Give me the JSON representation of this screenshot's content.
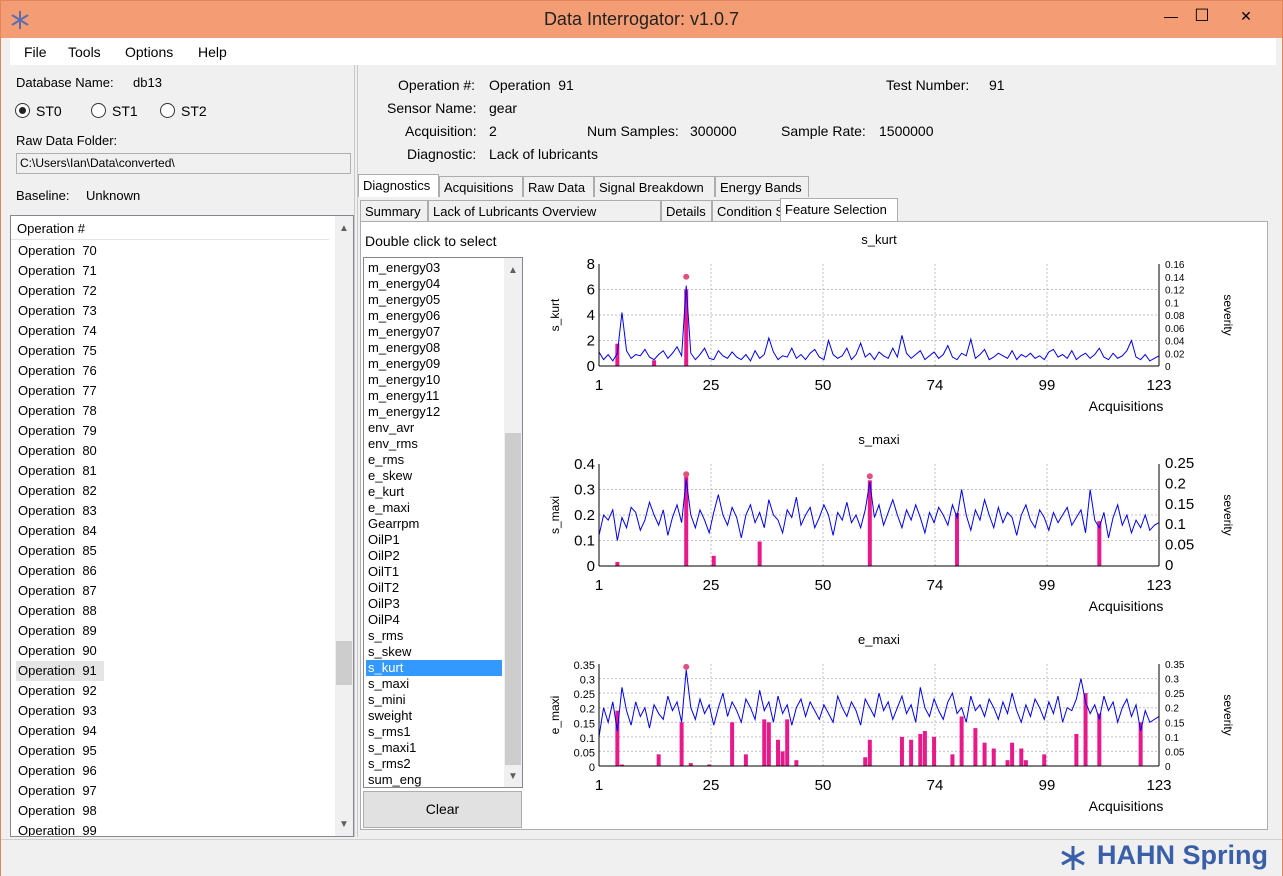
{
  "window": {
    "title": "Data Interrogator: v1.0.7",
    "minimize": "—",
    "maximize": "☐",
    "close": "✕"
  },
  "menu": [
    "File",
    "Tools",
    "Options",
    "Help"
  ],
  "left": {
    "db_label": "Database Name:",
    "db_value": "db13",
    "radios": [
      {
        "label": "ST0",
        "checked": true
      },
      {
        "label": "ST1",
        "checked": false
      },
      {
        "label": "ST2",
        "checked": false
      }
    ],
    "raw_folder_label": "Raw Data Folder:",
    "raw_folder_value": "C:\\Users\\Ian\\Data\\converted\\",
    "baseline_label": "Baseline:",
    "baseline_value": "Unknown",
    "list_header": "Operation #",
    "operations": [
      "Operation  70",
      "Operation  71",
      "Operation  72",
      "Operation  73",
      "Operation  74",
      "Operation  75",
      "Operation  76",
      "Operation  77",
      "Operation  78",
      "Operation  79",
      "Operation  80",
      "Operation  81",
      "Operation  82",
      "Operation  83",
      "Operation  84",
      "Operation  85",
      "Operation  86",
      "Operation  87",
      "Operation  88",
      "Operation  89",
      "Operation  90",
      "Operation  91",
      "Operation  92",
      "Operation  93",
      "Operation  94",
      "Operation  95",
      "Operation  96",
      "Operation  97",
      "Operation  98",
      "Operation  99"
    ],
    "selected_operation": "Operation  91"
  },
  "info": {
    "operation_label": "Operation #:",
    "operation_value": "Operation  91",
    "test_label": "Test Number:",
    "test_value": "91",
    "sensor_label": "Sensor Name:",
    "sensor_value": "gear",
    "acq_label": "Acquisition:",
    "acq_value": "2",
    "samples_label": "Num Samples:",
    "samples_value": "300000",
    "rate_label": "Sample Rate:",
    "rate_value": "1500000",
    "diag_label": "Diagnostic:",
    "diag_value": "Lack of lubricants"
  },
  "tabs_main": [
    "Diagnostics",
    "Acquisitions",
    "Raw Data",
    "Signal Breakdown",
    "Energy Bands"
  ],
  "tabs_sub": [
    "Summary",
    "Lack of Lubricants Overview",
    "Details",
    "Condition Severity",
    "Feature Selection"
  ],
  "feature_panel": {
    "instruction": "Double click to select",
    "features": [
      "m_energy03",
      "m_energy04",
      "m_energy05",
      "m_energy06",
      "m_energy07",
      "m_energy08",
      "m_energy09",
      "m_energy10",
      "m_energy11",
      "m_energy12",
      "env_avr",
      "env_rms",
      "e_rms",
      "e_skew",
      "e_kurt",
      "e_maxi",
      "Gearrpm",
      "OilP1",
      "OilP2",
      "OilT1",
      "OilT2",
      "OilP3",
      "OilP4",
      "s_rms",
      "s_skew",
      "s_kurt",
      "s_maxi",
      "s_mini",
      "sweight",
      "s_rms1",
      "s_maxi1",
      "s_rms2",
      "sum_eng"
    ],
    "selected_feature": "s_kurt",
    "clear_label": "Clear"
  },
  "footer": {
    "logo_text": "HAHN Spring"
  },
  "chart_data": [
    {
      "type": "line",
      "title": "s_kurt",
      "ylabel": "s_kurt",
      "y2label": "severity",
      "xlabel": "Acquisitions",
      "xticks": [
        "1",
        "25",
        "50",
        "74",
        "99",
        "123"
      ],
      "xlim": [
        1,
        123
      ],
      "ylim": [
        0,
        8
      ],
      "yticks": [
        "0",
        "2",
        "4",
        "6",
        "8"
      ],
      "y2lim": [
        0,
        0.16
      ],
      "y2ticks": [
        "0",
        "0.02",
        "0.04",
        "0.06",
        "0.08",
        "0.1",
        "0.12",
        "0.14",
        "0.16"
      ],
      "line_color": "#0000ee",
      "bar_color": "#e8198b",
      "line_values": [
        1.1,
        0.5,
        0.9,
        0.4,
        1.0,
        4.2,
        1.2,
        0.6,
        0.9,
        0.8,
        1.3,
        0.7,
        0.5,
        0.9,
        1.2,
        0.6,
        1.0,
        1.5,
        0.8,
        6.3,
        1.0,
        0.5,
        0.9,
        1.4,
        0.6,
        0.5,
        1.2,
        0.8,
        0.6,
        1.1,
        0.7,
        0.5,
        0.9,
        0.4,
        1.2,
        0.6,
        0.9,
        2.2,
        1.1,
        0.5,
        0.8,
        0.7,
        1.4,
        0.6,
        0.9,
        0.5,
        1.0,
        1.3,
        0.7,
        0.5,
        2.0,
        0.9,
        0.6,
        0.8,
        1.4,
        0.5,
        0.9,
        1.8,
        0.7,
        1.0,
        0.5,
        1.1,
        0.8,
        0.6,
        1.4,
        0.7,
        2.4,
        1.0,
        0.6,
        0.9,
        1.2,
        0.5,
        0.8,
        1.1,
        0.6,
        0.9,
        1.6,
        0.7,
        0.5,
        1.0,
        0.8,
        2.1,
        0.6,
        0.9,
        1.3,
        0.5,
        0.7,
        1.0,
        0.8,
        0.6,
        1.2,
        0.5,
        0.9,
        0.7,
        1.0,
        0.6,
        0.8,
        0.5,
        1.1,
        1.3,
        0.7,
        0.9,
        0.6,
        1.2,
        0.5,
        0.8,
        1.0,
        0.6,
        0.9,
        1.4,
        0.7,
        0.5,
        1.0,
        0.6,
        0.8,
        1.2,
        2.0,
        0.7,
        0.5,
        0.9,
        0.4,
        0.6,
        0.8
      ],
      "bars": [
        [
          5,
          0.035
        ],
        [
          13,
          0.009
        ],
        [
          20,
          0.12
        ]
      ],
      "markers": [
        [
          20,
          0.14
        ]
      ]
    },
    {
      "type": "line",
      "title": "s_maxi",
      "ylabel": "s_maxi",
      "y2label": "severity",
      "xlabel": "Acquisitions",
      "xticks": [
        "1",
        "25",
        "50",
        "74",
        "99",
        "123"
      ],
      "xlim": [
        1,
        123
      ],
      "ylim": [
        0,
        0.4
      ],
      "yticks": [
        "0",
        "0.1",
        "0.2",
        "0.3",
        "0.4"
      ],
      "y2lim": [
        0,
        0.25
      ],
      "y2ticks": [
        "0",
        "0.05",
        "0.1",
        "0.15",
        "0.2",
        "0.25"
      ],
      "line_color": "#0000ee",
      "bar_color": "#e8198b",
      "line_values": [
        0.12,
        0.2,
        0.18,
        0.22,
        0.1,
        0.19,
        0.15,
        0.23,
        0.21,
        0.14,
        0.18,
        0.25,
        0.2,
        0.16,
        0.22,
        0.12,
        0.19,
        0.24,
        0.17,
        0.34,
        0.2,
        0.15,
        0.22,
        0.18,
        0.13,
        0.21,
        0.28,
        0.2,
        0.16,
        0.23,
        0.19,
        0.11,
        0.2,
        0.24,
        0.17,
        0.21,
        0.15,
        0.26,
        0.2,
        0.18,
        0.13,
        0.22,
        0.19,
        0.27,
        0.16,
        0.2,
        0.23,
        0.15,
        0.19,
        0.24,
        0.2,
        0.12,
        0.21,
        0.18,
        0.25,
        0.17,
        0.2,
        0.15,
        0.22,
        0.33,
        0.19,
        0.24,
        0.16,
        0.21,
        0.26,
        0.2,
        0.15,
        0.22,
        0.18,
        0.24,
        0.19,
        0.13,
        0.21,
        0.17,
        0.23,
        0.2,
        0.16,
        0.24,
        0.19,
        0.3,
        0.2,
        0.14,
        0.22,
        0.18,
        0.26,
        0.2,
        0.15,
        0.23,
        0.17,
        0.21,
        0.19,
        0.12,
        0.2,
        0.24,
        0.18,
        0.15,
        0.22,
        0.19,
        0.14,
        0.21,
        0.17,
        0.2,
        0.23,
        0.16,
        0.19,
        0.22,
        0.13,
        0.3,
        0.18,
        0.15,
        0.21,
        0.11,
        0.19,
        0.24,
        0.16,
        0.2,
        0.13,
        0.18,
        0.15,
        0.2,
        0.14,
        0.16,
        0.17
      ],
      "bars": [
        [
          5,
          0.01
        ],
        [
          20,
          0.22
        ],
        [
          26,
          0.025
        ],
        [
          36,
          0.06
        ],
        [
          60,
          0.21
        ],
        [
          79,
          0.13
        ],
        [
          110,
          0.11
        ]
      ],
      "markers": [
        [
          20,
          0.225
        ],
        [
          60,
          0.22
        ]
      ]
    },
    {
      "type": "line",
      "title": "e_maxi",
      "ylabel": "e_maxi",
      "y2label": "severity",
      "xlabel": "Acquisitions",
      "xticks": [
        "1",
        "25",
        "50",
        "74",
        "99",
        "123"
      ],
      "xlim": [
        1,
        123
      ],
      "ylim": [
        0,
        0.35
      ],
      "yticks": [
        "0",
        "0.05",
        "0.1",
        "0.15",
        "0.2",
        "0.25",
        "0.3",
        "0.35"
      ],
      "y2lim": [
        0,
        0.35
      ],
      "y2ticks": [
        "0",
        "0.05",
        "0.1",
        "0.15",
        "0.2",
        "0.25",
        "0.3",
        "0.35"
      ],
      "line_color": "#0000ee",
      "bar_color": "#e8198b",
      "line_values": [
        0.1,
        0.2,
        0.15,
        0.22,
        0.12,
        0.27,
        0.19,
        0.14,
        0.22,
        0.17,
        0.2,
        0.13,
        0.21,
        0.18,
        0.16,
        0.24,
        0.19,
        0.22,
        0.15,
        0.33,
        0.2,
        0.16,
        0.23,
        0.18,
        0.21,
        0.14,
        0.2,
        0.25,
        0.17,
        0.22,
        0.19,
        0.15,
        0.23,
        0.2,
        0.16,
        0.26,
        0.19,
        0.22,
        0.15,
        0.24,
        0.18,
        0.21,
        0.14,
        0.2,
        0.23,
        0.17,
        0.22,
        0.19,
        0.16,
        0.21,
        0.18,
        0.15,
        0.24,
        0.2,
        0.17,
        0.22,
        0.19,
        0.14,
        0.23,
        0.2,
        0.17,
        0.25,
        0.19,
        0.22,
        0.16,
        0.2,
        0.24,
        0.18,
        0.21,
        0.15,
        0.27,
        0.2,
        0.17,
        0.23,
        0.19,
        0.16,
        0.22,
        0.25,
        0.18,
        0.2,
        0.15,
        0.24,
        0.19,
        0.21,
        0.17,
        0.23,
        0.2,
        0.16,
        0.22,
        0.18,
        0.25,
        0.19,
        0.15,
        0.21,
        0.17,
        0.23,
        0.2,
        0.16,
        0.22,
        0.18,
        0.24,
        0.15,
        0.2,
        0.19,
        0.23,
        0.3,
        0.22,
        0.18,
        0.21,
        0.16,
        0.24,
        0.19,
        0.22,
        0.15,
        0.2,
        0.23,
        0.17,
        0.21,
        0.12,
        0.19,
        0.15,
        0.16,
        0.17
      ],
      "bars": [
        [
          5,
          0.19
        ],
        [
          6,
          0.005
        ],
        [
          14,
          0.04
        ],
        [
          19,
          0.15
        ],
        [
          21,
          0.01
        ],
        [
          25,
          0.005
        ],
        [
          30,
          0.15
        ],
        [
          33,
          0.04
        ],
        [
          37,
          0.16
        ],
        [
          38,
          0.15
        ],
        [
          40,
          0.09
        ],
        [
          41,
          0.05
        ],
        [
          42,
          0.16
        ],
        [
          44,
          0.02
        ],
        [
          59,
          0.03
        ],
        [
          60,
          0.09
        ],
        [
          67,
          0.1
        ],
        [
          69,
          0.09
        ],
        [
          71,
          0.11
        ],
        [
          72,
          0.12
        ],
        [
          74,
          0.1
        ],
        [
          78,
          0.04
        ],
        [
          80,
          0.17
        ],
        [
          83,
          0.13
        ],
        [
          85,
          0.08
        ],
        [
          87,
          0.06
        ],
        [
          90,
          0.02
        ],
        [
          91,
          0.08
        ],
        [
          93,
          0.06
        ],
        [
          94,
          0.02
        ],
        [
          98,
          0.04
        ],
        [
          105,
          0.11
        ],
        [
          107,
          0.25
        ],
        [
          110,
          0.18
        ],
        [
          119,
          0.15
        ]
      ],
      "markers": [
        [
          20,
          0.34
        ]
      ]
    }
  ]
}
